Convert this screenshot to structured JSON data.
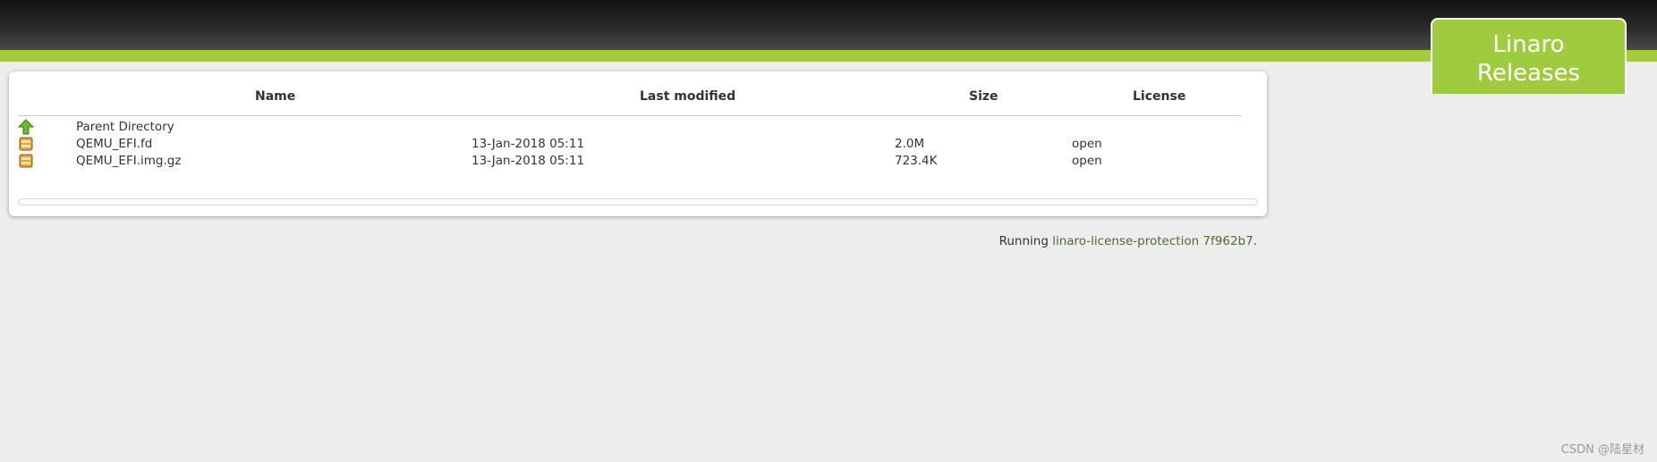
{
  "brand": {
    "line1": "Linaro",
    "line2": "Releases",
    "color": "#9fcb3e"
  },
  "table": {
    "headers": {
      "name": "Name",
      "last_modified": "Last modified",
      "size": "Size",
      "license": "License"
    },
    "parent": {
      "label": "Parent Directory",
      "icon": "up-arrow-icon"
    },
    "rows": [
      {
        "name": "QEMU_EFI.fd",
        "last_modified": "13-Jan-2018 05:11",
        "size": "2.0M",
        "license": "open",
        "icon": "archive-file-icon"
      },
      {
        "name": "QEMU_EFI.img.gz",
        "last_modified": "13-Jan-2018 05:11",
        "size": "723.4K",
        "license": "open",
        "icon": "archive-file-icon"
      }
    ]
  },
  "footer": {
    "prefix": "Running ",
    "link_text": "linaro-license-protection 7f962b7",
    "suffix": "."
  },
  "watermark": "CSDN @陆星材",
  "colors": {
    "accent_green": "#a4cc3c",
    "link_green": "#4f6b2f",
    "background": "#ededed"
  }
}
